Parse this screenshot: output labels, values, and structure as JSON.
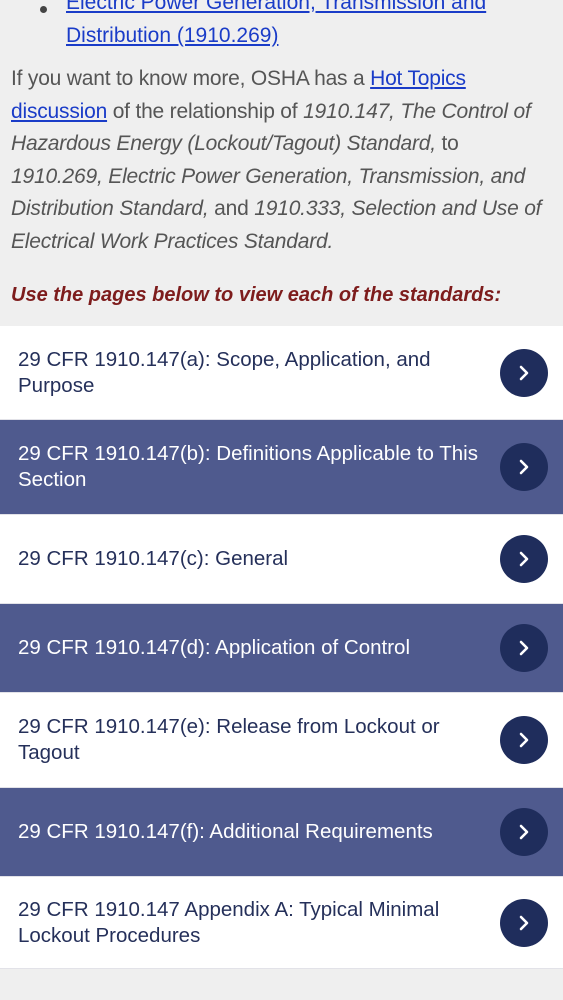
{
  "bullet": {
    "line1": "Electric Power Generation, Transmission and",
    "line2": "Distribution (1910.269)"
  },
  "intro": {
    "text_before_link": "If you want to know more, OSHA has a ",
    "link": "Hot Topics discussion",
    "text_after_link": " of the relationship of ",
    "ref1": "1910.147, The Control of Hazardous Energy (Lockout/Tagout) Standard,",
    "to": " to ",
    "ref2": "1910.269, Electric Power Generation, Transmission, and Distribution Standard,",
    "and": " and ",
    "ref3": "1910.333, Selection and Use of Electrical Work Practices Standard."
  },
  "prompt": "Use the pages below to view each of the standards:",
  "items": [
    {
      "label": "29 CFR 1910.147(a): Scope, Application, and Purpose"
    },
    {
      "label": "29 CFR 1910.147(b): Definitions Applicable to This Section"
    },
    {
      "label": "29 CFR 1910.147(c): General"
    },
    {
      "label": "29 CFR 1910.147(d): Application of Control"
    },
    {
      "label": "29 CFR 1910.147(e): Release from Lockout or Tagout"
    },
    {
      "label": "29 CFR 1910.147(f): Additional Requirements"
    },
    {
      "label": "29 CFR 1910.147 Appendix A: Typical Minimal Lockout Procedures"
    }
  ],
  "icons": {
    "item_arrow": "chevron-right-icon",
    "bullet": "bullet-dot-icon"
  },
  "colors": {
    "link": "#1a3cc8",
    "prompt": "#7d1c1c",
    "row_dark": "#4f5a8e",
    "row_light": "#ffffff",
    "chevron_circle": "#1f2d5c"
  }
}
